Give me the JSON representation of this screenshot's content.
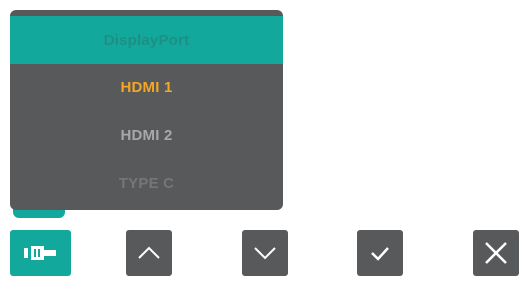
{
  "osd_menu": {
    "items": [
      {
        "label": "DisplayPort",
        "state": "highlighted"
      },
      {
        "label": "HDMI 1",
        "state": "active"
      },
      {
        "label": "HDMI 2",
        "state": "normal"
      },
      {
        "label": "TYPE C",
        "state": "disabled"
      }
    ]
  },
  "buttons": [
    {
      "icon": "input-source-icon"
    },
    {
      "icon": "chevron-up-icon"
    },
    {
      "icon": "chevron-down-icon"
    },
    {
      "icon": "checkmark-icon"
    },
    {
      "icon": "close-icon"
    }
  ],
  "colors": {
    "accent": "#12a89b",
    "panel": "#58595b",
    "active_text": "#f5a623",
    "normal_text": "#a7a8aa",
    "disabled_text": "#757678",
    "highlighted_text": "#1f8f85",
    "icon": "#ffffff"
  }
}
